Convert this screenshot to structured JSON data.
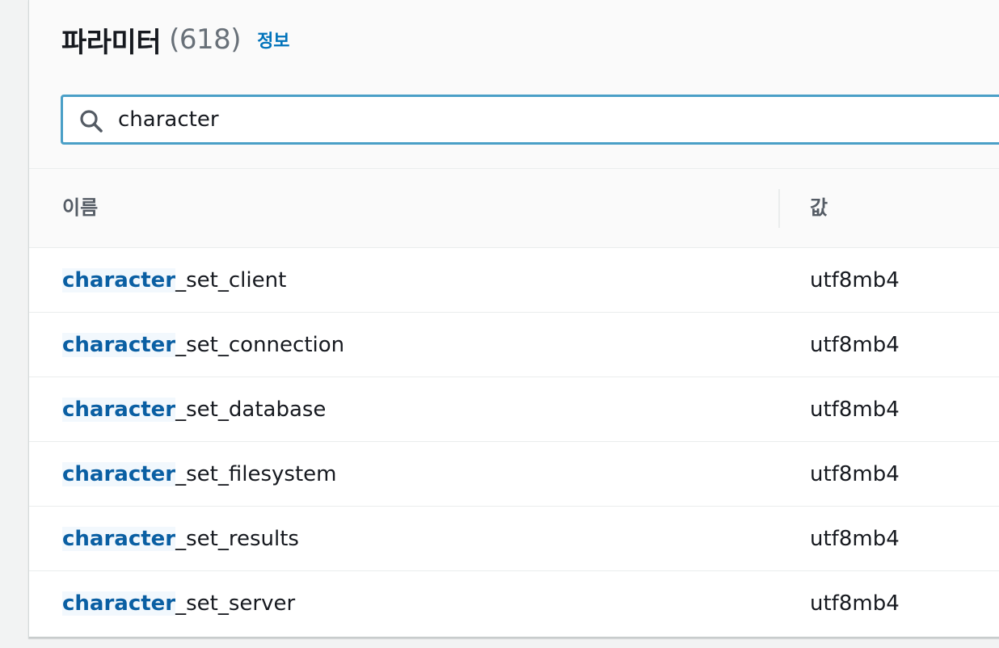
{
  "header": {
    "title": "파라미터",
    "count": "(618)",
    "info_link": "정보"
  },
  "search": {
    "value": "character",
    "icon": "search-icon"
  },
  "table": {
    "columns": [
      "이름",
      "값"
    ],
    "rows": [
      {
        "match": "character",
        "rest": "_set_client",
        "value": "utf8mb4"
      },
      {
        "match": "character",
        "rest": "_set_connection",
        "value": "utf8mb4"
      },
      {
        "match": "character",
        "rest": "_set_database",
        "value": "utf8mb4"
      },
      {
        "match": "character",
        "rest": "_set_filesystem",
        "value": "utf8mb4"
      },
      {
        "match": "character",
        "rest": "_set_results",
        "value": "utf8mb4"
      },
      {
        "match": "character",
        "rest": "_set_server",
        "value": "utf8mb4"
      }
    ]
  },
  "colors": {
    "link": "#0073bb",
    "highlight_text": "#0a5fa3",
    "focus_border": "#4a9fc7"
  }
}
